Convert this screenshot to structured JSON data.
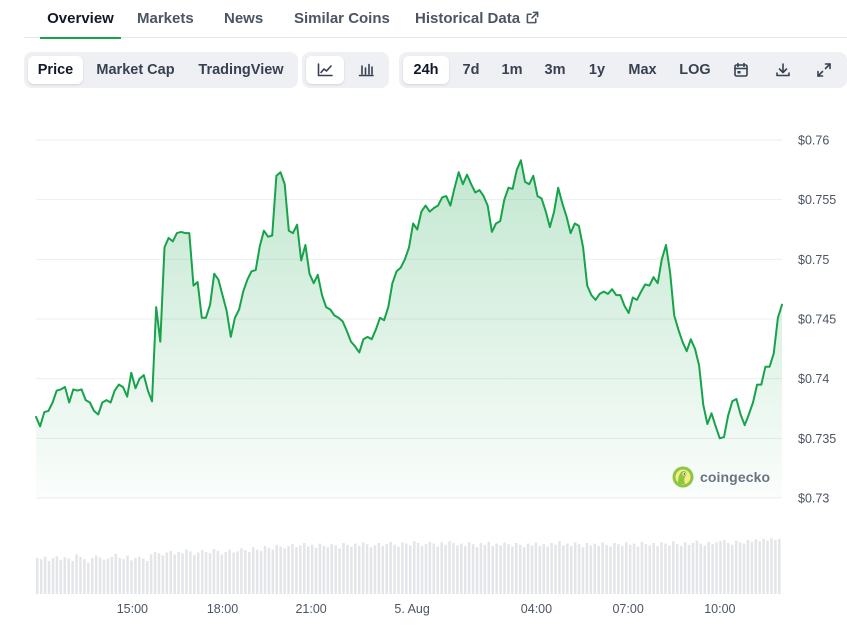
{
  "tabs": [
    {
      "label": "Overview",
      "active": true
    },
    {
      "label": "Markets"
    },
    {
      "label": "News"
    },
    {
      "label": "Similar Coins"
    },
    {
      "label": "Historical Data",
      "icon": "external-link-icon"
    }
  ],
  "toolbar": {
    "view_buttons": [
      {
        "label": "Price",
        "active": true
      },
      {
        "label": "Market Cap"
      },
      {
        "label": "TradingView"
      }
    ],
    "chart_type_buttons": [
      {
        "icon": "line-chart-icon",
        "active": true
      },
      {
        "icon": "candlestick-chart-icon"
      }
    ],
    "range_buttons": [
      {
        "label": "24h",
        "active": true
      },
      {
        "label": "7d"
      },
      {
        "label": "1m"
      },
      {
        "label": "3m"
      },
      {
        "label": "1y"
      },
      {
        "label": "Max"
      },
      {
        "label": "LOG"
      }
    ],
    "action_icons": [
      "calendar-icon",
      "download-icon",
      "fullscreen-icon"
    ]
  },
  "watermark": "coingecko",
  "colors": {
    "line": "#16a34a",
    "area_top": "#16a34a",
    "accent_tab": "#16a34a",
    "volume_bar": "#e3e5e8"
  },
  "chart_data": {
    "type": "area",
    "y_ticks": [
      "$0.76",
      "$0.755",
      "$0.75",
      "$0.745",
      "$0.74",
      "$0.735",
      "$0.73"
    ],
    "y_tick_values": [
      0.76,
      0.755,
      0.75,
      0.745,
      0.74,
      0.735,
      0.73
    ],
    "ylim": [
      0.73,
      0.76
    ],
    "x_ticks": [
      {
        "label": "15:00",
        "hour": 3.1
      },
      {
        "label": "18:00",
        "hour": 6.0
      },
      {
        "label": "21:00",
        "hour": 8.85
      },
      {
        "label": "5. Aug",
        "hour": 12.1
      },
      {
        "label": "04:00",
        "hour": 16.1
      },
      {
        "label": "07:00",
        "hour": 19.05
      },
      {
        "label": "10:00",
        "hour": 22.0
      }
    ],
    "xlim": [
      0,
      24
    ],
    "grid": true,
    "price": [
      0.7368,
      0.736,
      0.7372,
      0.7373,
      0.738,
      0.739,
      0.7391,
      0.7393,
      0.738,
      0.7391,
      0.739,
      0.7391,
      0.7382,
      0.738,
      0.7373,
      0.737,
      0.738,
      0.7382,
      0.738,
      0.739,
      0.7395,
      0.7393,
      0.7385,
      0.7405,
      0.7392,
      0.74,
      0.7403,
      0.739,
      0.7381,
      0.746,
      0.7431,
      0.751,
      0.7518,
      0.7515,
      0.7522,
      0.7523,
      0.7522,
      0.7522,
      0.7478,
      0.7481,
      0.7451,
      0.7451,
      0.7462,
      0.7488,
      0.7483,
      0.747,
      0.7457,
      0.7435,
      0.7451,
      0.7458,
      0.7473,
      0.7483,
      0.749,
      0.7491,
      0.7511,
      0.7524,
      0.7519,
      0.752,
      0.757,
      0.7573,
      0.7563,
      0.7524,
      0.7522,
      0.7529,
      0.7499,
      0.7512,
      0.7488,
      0.748,
      0.7487,
      0.747,
      0.746,
      0.7458,
      0.7453,
      0.7451,
      0.7448,
      0.744,
      0.7431,
      0.7427,
      0.7422,
      0.7433,
      0.7435,
      0.7433,
      0.7441,
      0.7451,
      0.7449,
      0.746,
      0.748,
      0.749,
      0.7493,
      0.75,
      0.751,
      0.753,
      0.7525,
      0.754,
      0.7545,
      0.754,
      0.7543,
      0.7545,
      0.7552,
      0.7553,
      0.7545,
      0.756,
      0.7573,
      0.7563,
      0.7571,
      0.7563,
      0.7556,
      0.7558,
      0.7553,
      0.7545,
      0.7523,
      0.753,
      0.7532,
      0.755,
      0.756,
      0.7559,
      0.7575,
      0.7583,
      0.7565,
      0.7563,
      0.757,
      0.7553,
      0.7551,
      0.754,
      0.7527,
      0.754,
      0.756,
      0.7547,
      0.7536,
      0.7522,
      0.753,
      0.7528,
      0.751,
      0.7478,
      0.747,
      0.7466,
      0.7471,
      0.7473,
      0.7471,
      0.7475,
      0.747,
      0.747,
      0.7461,
      0.7455,
      0.7468,
      0.7466,
      0.7473,
      0.7479,
      0.7478,
      0.7485,
      0.748,
      0.75,
      0.7512,
      0.7489,
      0.7453,
      0.7441,
      0.7431,
      0.7423,
      0.7433,
      0.7425,
      0.7411,
      0.7378,
      0.7362,
      0.7371,
      0.736,
      0.735,
      0.7351,
      0.7369,
      0.7381,
      0.7383,
      0.737,
      0.7361,
      0.737,
      0.738,
      0.7395,
      0.7395,
      0.741,
      0.741,
      0.7421,
      0.7451,
      0.7462
    ],
    "volume": [
      0.6,
      0.58,
      0.62,
      0.55,
      0.6,
      0.63,
      0.57,
      0.61,
      0.59,
      0.55,
      0.66,
      0.62,
      0.58,
      0.52,
      0.6,
      0.64,
      0.61,
      0.57,
      0.59,
      0.62,
      0.67,
      0.6,
      0.58,
      0.64,
      0.56,
      0.6,
      0.62,
      0.59,
      0.55,
      0.66,
      0.7,
      0.68,
      0.64,
      0.69,
      0.72,
      0.66,
      0.7,
      0.68,
      0.74,
      0.71,
      0.65,
      0.69,
      0.73,
      0.7,
      0.68,
      0.75,
      0.72,
      0.66,
      0.7,
      0.74,
      0.69,
      0.71,
      0.76,
      0.73,
      0.7,
      0.78,
      0.74,
      0.72,
      0.8,
      0.77,
      0.74,
      0.82,
      0.79,
      0.76,
      0.8,
      0.83,
      0.78,
      0.81,
      0.85,
      0.79,
      0.82,
      0.77,
      0.84,
      0.8,
      0.78,
      0.83,
      0.81,
      0.76,
      0.85,
      0.82,
      0.79,
      0.84,
      0.8,
      0.86,
      0.83,
      0.78,
      0.81,
      0.85,
      0.8,
      0.83,
      0.87,
      0.82,
      0.79,
      0.86,
      0.84,
      0.81,
      0.88,
      0.85,
      0.8,
      0.83,
      0.87,
      0.84,
      0.79,
      0.86,
      0.82,
      0.88,
      0.85,
      0.81,
      0.84,
      0.8,
      0.86,
      0.83,
      0.78,
      0.85,
      0.82,
      0.87,
      0.8,
      0.84,
      0.81,
      0.86,
      0.83,
      0.79,
      0.85,
      0.82,
      0.78,
      0.84,
      0.81,
      0.86,
      0.8,
      0.83,
      0.79,
      0.85,
      0.82,
      0.88,
      0.81,
      0.84,
      0.8,
      0.86,
      0.83,
      0.78,
      0.85,
      0.81,
      0.84,
      0.8,
      0.86,
      0.82,
      0.79,
      0.85,
      0.83,
      0.8,
      0.86,
      0.82,
      0.84,
      0.79,
      0.87,
      0.83,
      0.81,
      0.85,
      0.8,
      0.86,
      0.84,
      0.81,
      0.88,
      0.83,
      0.8,
      0.86,
      0.82,
      0.85,
      0.89,
      0.84,
      0.81,
      0.87,
      0.83,
      0.86,
      0.88,
      0.9,
      0.85,
      0.82,
      0.89,
      0.86,
      0.84,
      0.9,
      0.87,
      0.91,
      0.88,
      0.92,
      0.89,
      0.93,
      0.9,
      0.92
    ]
  }
}
